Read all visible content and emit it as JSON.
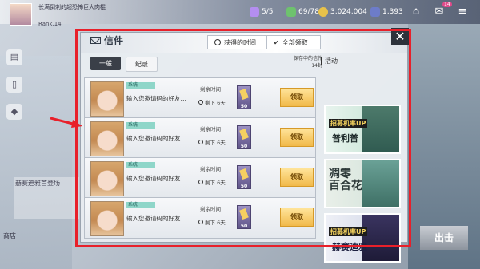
{
  "player": {
    "name": "长满倒刺的超恐怖巨大肉棍",
    "rank": "Rank.14"
  },
  "resources": [
    {
      "icon": "energy-icon",
      "value": "5/5",
      "color": "#b48ef0"
    },
    {
      "icon": "stamina-icon",
      "value": "69/78",
      "color": "#6ec26e"
    },
    {
      "icon": "coin-icon",
      "value": "3,024,004",
      "color": "#e8c24a"
    },
    {
      "icon": "gem-icon",
      "value": "1,393",
      "color": "#6d7cc9"
    }
  ],
  "mail_badge": "14",
  "dialog": {
    "title": "信件",
    "sort_button": "获得的时间",
    "claim_all_button": "全部领取",
    "tabs": [
      "一般",
      "纪录"
    ],
    "saved_label": "保存中的信件",
    "saved_count": "14封"
  },
  "mails": [
    {
      "sender": "系统",
      "subject": "输入您邀请码的好友…",
      "time_label": "剩余时间",
      "time_remaining": "剩下 6天",
      "item_qty": "50",
      "claim": "领取"
    },
    {
      "sender": "系统",
      "subject": "输入您邀请码的好友…",
      "time_label": "剩余时间",
      "time_remaining": "剩下 6天",
      "item_qty": "50",
      "claim": "领取"
    },
    {
      "sender": "系统",
      "subject": "输入您邀请码的好友…",
      "time_label": "剩余时间",
      "time_remaining": "剩下 6天",
      "item_qty": "50",
      "claim": "领取"
    },
    {
      "sender": "系统",
      "subject": "输入您邀请码的好友…",
      "time_label": "剩余时间",
      "time_remaining": "剩下 6天",
      "item_qty": "50",
      "claim": "领取"
    }
  ],
  "activity": {
    "title": "活动",
    "banners": [
      {
        "tag": "招募机率UP",
        "name": "普利普"
      },
      {
        "title_top": "凋零",
        "title_bottom": "百合花"
      },
      {
        "tag": "招募机率UP",
        "name": "赫赛迪雅"
      }
    ]
  },
  "background": {
    "exit_label": "出击",
    "left_banner_text": "赫赛迪雅首登场",
    "bottom_left": "商店"
  },
  "colors": {
    "highlight": "#e8202a",
    "claim_button": "#f1b94a",
    "tab_active": "#3a3f48"
  }
}
